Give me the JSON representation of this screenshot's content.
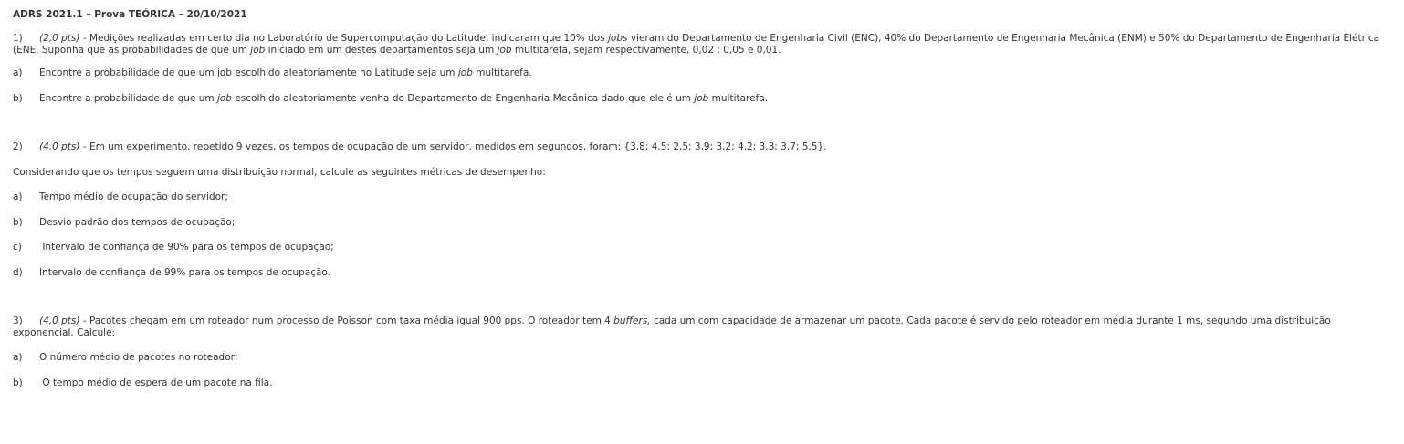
{
  "title": "ADRS 2021.1 – Prova TEÓRICA – 20/10/2021",
  "q1": {
    "num": "1)",
    "pts": "(2,0 pts)",
    "t1": " - Medições realizadas em certo dia no Laboratório de Supercomputação do Latitude, indicaram que 10% dos ",
    "jobs": "jobs",
    "t2": " vieram do Departamento de Engenharia Civil (ENC), 40% do Departamento de Engenharia Mecânica (ENM) e 50% do Departamento de Engenharia Elétrica",
    "t3": "(ENE. Suponha que as probabilidades de que um ",
    "job1": "job",
    "t4": " iniciado em um destes departamentos seja um ",
    "job2": "job",
    "t5": " multitarefa, sejam respectivamente, 0,02 ; 0,05 e 0,01.",
    "a": {
      "label": "a)",
      "t1": "Encontre a probabilidade de que um job escolhido aleatoriamente no Latitude seja um ",
      "job": "job",
      "t2": " multitarefa."
    },
    "b": {
      "label": "b)",
      "t1": "Encontre a probabilidade de que um ",
      "job1": "job",
      "t2": " escolhido aleatoriamente venha do Departamento de Engenharia Mecânica dado que ele é um ",
      "job2": "job",
      "t3": " multitarefa."
    }
  },
  "q2": {
    "num": "2)",
    "pts": "(4,0 pts)",
    "t1": " - Em um experimento, repetido 9 vezes, os tempos de ocupação de um servidor, medidos em segundos, foram: {3,8; 4,5; 2,5; 3,9; 3,2; 4,2; 3,3; 3,7; 5,5}.",
    "intro": "Considerando que os tempos seguem uma distribuição normal, calcule as seguintes métricas de desempenho:",
    "items": [
      {
        "label": "a)",
        "text": "Tempo médio de ocupação do servidor;"
      },
      {
        "label": "b)",
        "text": "Desvio padrão dos tempos de ocupação;"
      },
      {
        "label": "c)",
        "text": " Intervalo de confiança de 90% para os tempos de ocupação;"
      },
      {
        "label": "d)",
        "text": "Intervalo de confiança de 99% para os tempos de ocupação."
      }
    ]
  },
  "q3": {
    "num": "3)",
    "pts": "(4,0 pts)",
    "t1": " - Pacotes chegam em um roteador num processo de Poisson com taxa média igual 900 pps. O roteador tem 4 ",
    "buffers": "buffers,",
    "t2": " cada um com capacidade de armazenar um pacote. Cada pacote é servido pelo roteador em média durante 1 ms, segundo uma distribuição",
    "t3": "exponencial. Calcule:",
    "items": [
      {
        "label": "a)",
        "text": "O número médio de pacotes no roteador;"
      },
      {
        "label": "b)",
        "text": " O tempo médio de espera de um pacote na fila."
      }
    ]
  }
}
